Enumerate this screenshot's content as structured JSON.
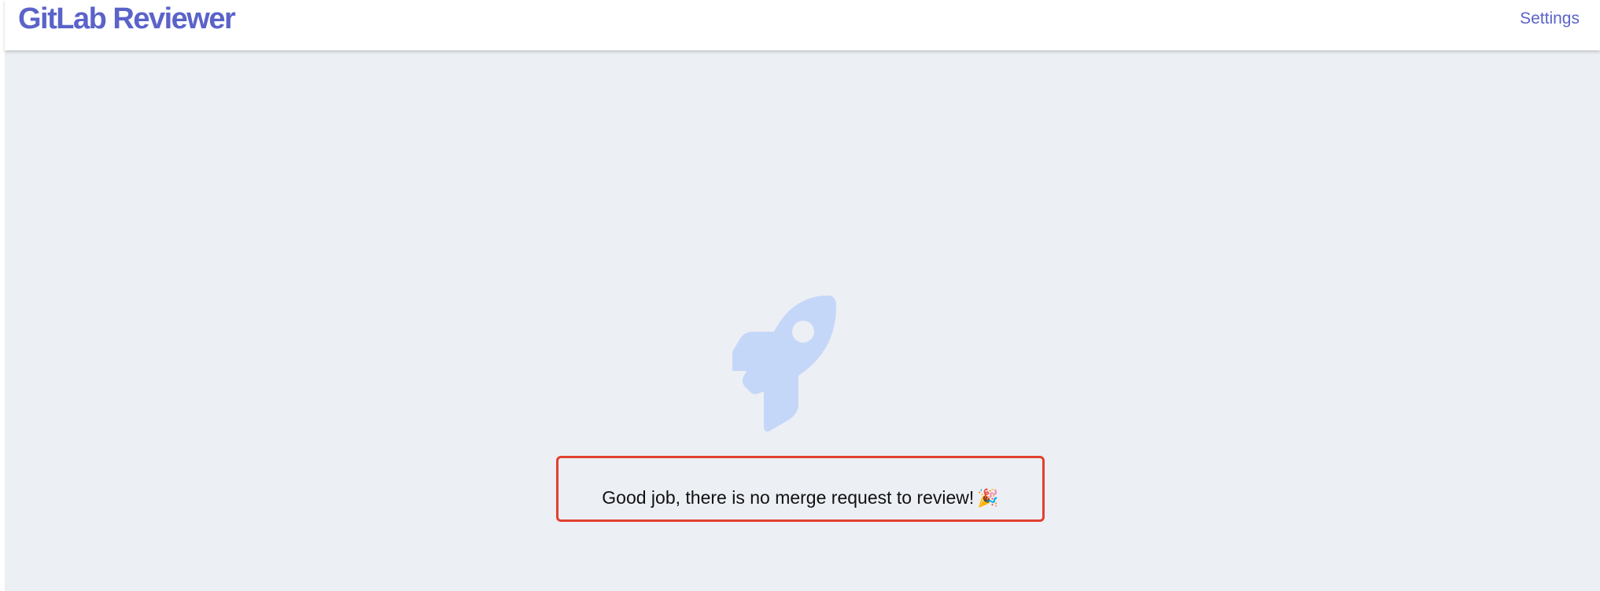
{
  "header": {
    "brand": "GitLab Reviewer",
    "settings_label": "Settings"
  },
  "empty_state": {
    "icon": "rocket-icon",
    "message": "Good job, there is no merge request to review!",
    "emoji": "🎉"
  },
  "colors": {
    "brand": "#5b63c9",
    "background": "#eceff4",
    "rocket": "#c5d7f8",
    "highlight_border": "#e2402e"
  }
}
